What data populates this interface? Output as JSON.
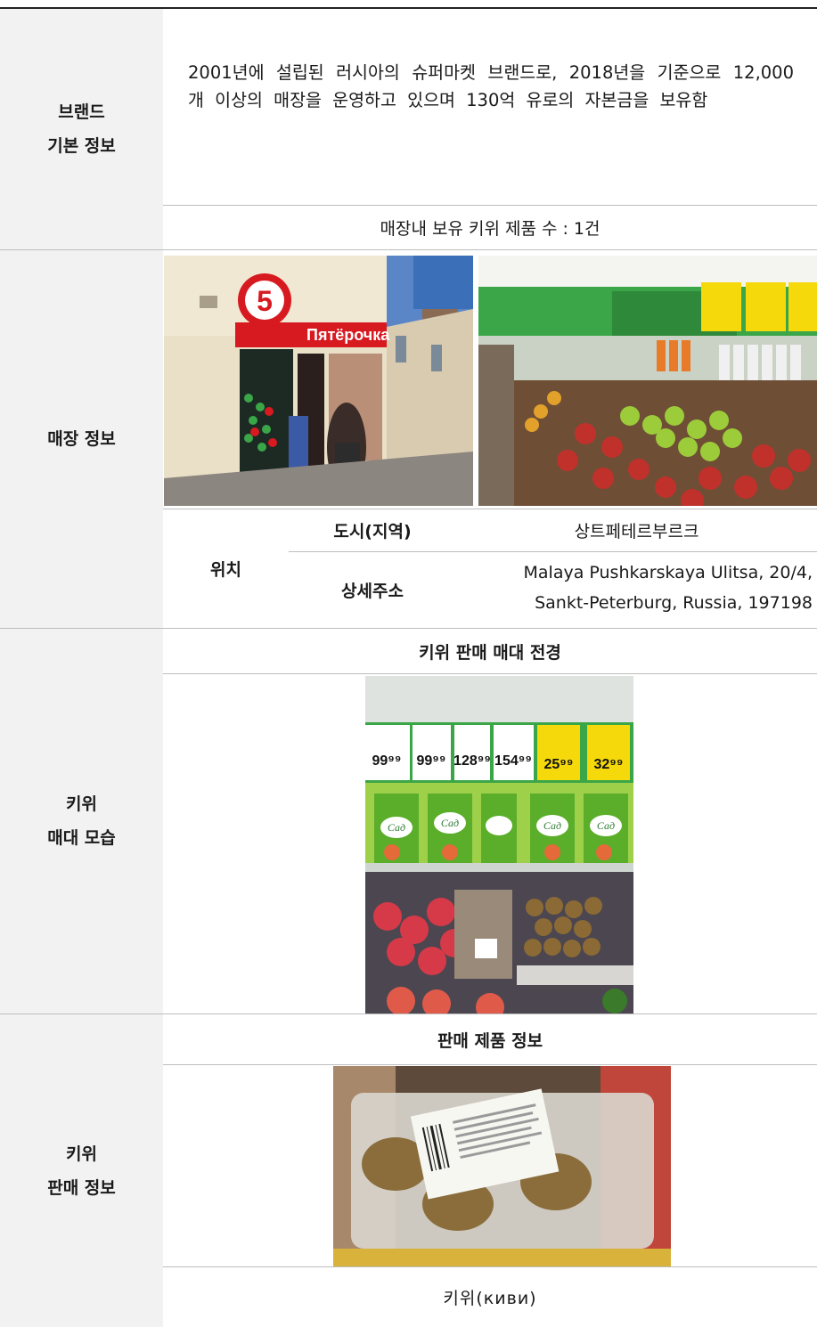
{
  "brand": {
    "label_line1": "브랜드",
    "label_line2": "기본 정보",
    "description": "2001년에 설립된 러시아의 슈퍼마켓 브랜드로, 2018년을 기준으로 12,000개 이상의 매장을 운영하고 있으며 130억 유로의 자본금을 보유함",
    "kiwi_count": "매장내 보유 키위 제품 수 : 1건"
  },
  "store": {
    "label": "매장 정보",
    "location_label": "위치",
    "city_label": "도시(지역)",
    "city_value": "상트페테르부르크",
    "address_label": "상세주소",
    "address_line1": "Malaya Pushkarskaya Ulitsa, 20/4,",
    "address_line2": "Sankt-Peterburg, Russia, 197198",
    "storefront_sign": "Пятёрочка",
    "storefront_logo_digit": "5"
  },
  "display": {
    "label_line1": "키위",
    "label_line2": "매대 모습",
    "header": "키위 판매 매대 전경",
    "price_tags": [
      "99⁹⁹",
      "99⁹⁹",
      "128⁹⁹",
      "154⁹⁹",
      "25⁹⁹",
      "32⁹⁹"
    ],
    "juice_brand": "Сад"
  },
  "product": {
    "label_line1": "키위",
    "label_line2": "판매 정보",
    "header": "판매 제품 정보",
    "name": "키위(киви)"
  },
  "colors": {
    "label_bg": "#f2f2f2",
    "rule": "#bdbdbd",
    "top_rule": "#222222",
    "brand_red": "#d71920",
    "shelf_green": "#3aa648",
    "price_yellow": "#f5d90a"
  }
}
